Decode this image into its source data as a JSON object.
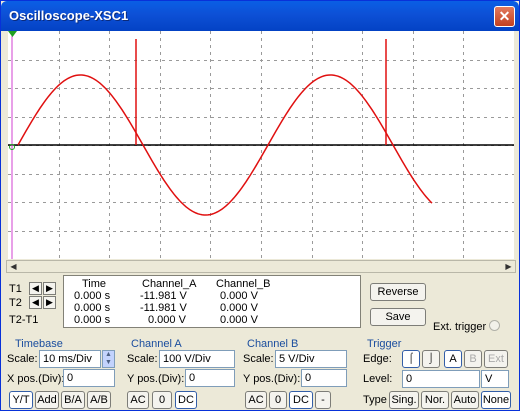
{
  "window": {
    "title": "Oscilloscope-XSC1",
    "close_symbol": "✕"
  },
  "cursor_table": {
    "headers": [
      "Time",
      "Channel_A",
      "Channel_B"
    ],
    "rows": [
      {
        "label": "T1",
        "time": "0.000 s",
        "channel_a": "-11.981 V",
        "channel_b": "0.000 V"
      },
      {
        "label": "T2",
        "time": "0.000 s",
        "channel_a": "-11.981 V",
        "channel_b": "0.000 V"
      },
      {
        "label": "T2-T1",
        "time": "0.000 s",
        "channel_a": "0.000 V",
        "channel_b": "0.000 V"
      }
    ]
  },
  "actions": {
    "reverse": "Reverse",
    "save": "Save",
    "ext_trigger": "Ext. trigger"
  },
  "timebase": {
    "title": "Timebase",
    "scale_label": "Scale:",
    "scale_value": "10 ms/Div",
    "xpos_label": "X pos.(Div):",
    "xpos_value": "0",
    "modes": [
      "Y/T",
      "Add",
      "B/A",
      "A/B"
    ]
  },
  "channel_a": {
    "title": "Channel A",
    "scale_label": "Scale:",
    "scale_value": "100  V/Div",
    "ypos_label": "Y pos.(Div):",
    "ypos_value": "0",
    "coupling": [
      "AC",
      "0",
      "DC"
    ]
  },
  "channel_b": {
    "title": "Channel B",
    "scale_label": "Scale:",
    "scale_value": "5  V/Div",
    "ypos_label": "Y pos.(Div):",
    "ypos_value": "0",
    "coupling": [
      "AC",
      "0",
      "DC",
      "-"
    ]
  },
  "trigger": {
    "title": "Trigger",
    "edge_label": "Edge:",
    "sources": [
      "A",
      "B",
      "Ext"
    ],
    "level_label": "Level:",
    "level_value": "0",
    "level_unit": "V",
    "type_label": "Type",
    "types": [
      "Sing.",
      "Nor.",
      "Auto",
      "None"
    ]
  },
  "colors": {
    "trace_a": "#e01010",
    "trace_b": "#000000",
    "grid": "#9a9a9a",
    "cursor_t1": "#d040d0",
    "cursor_t2": "#4040ff",
    "group_title": "#1a4d9e"
  }
}
